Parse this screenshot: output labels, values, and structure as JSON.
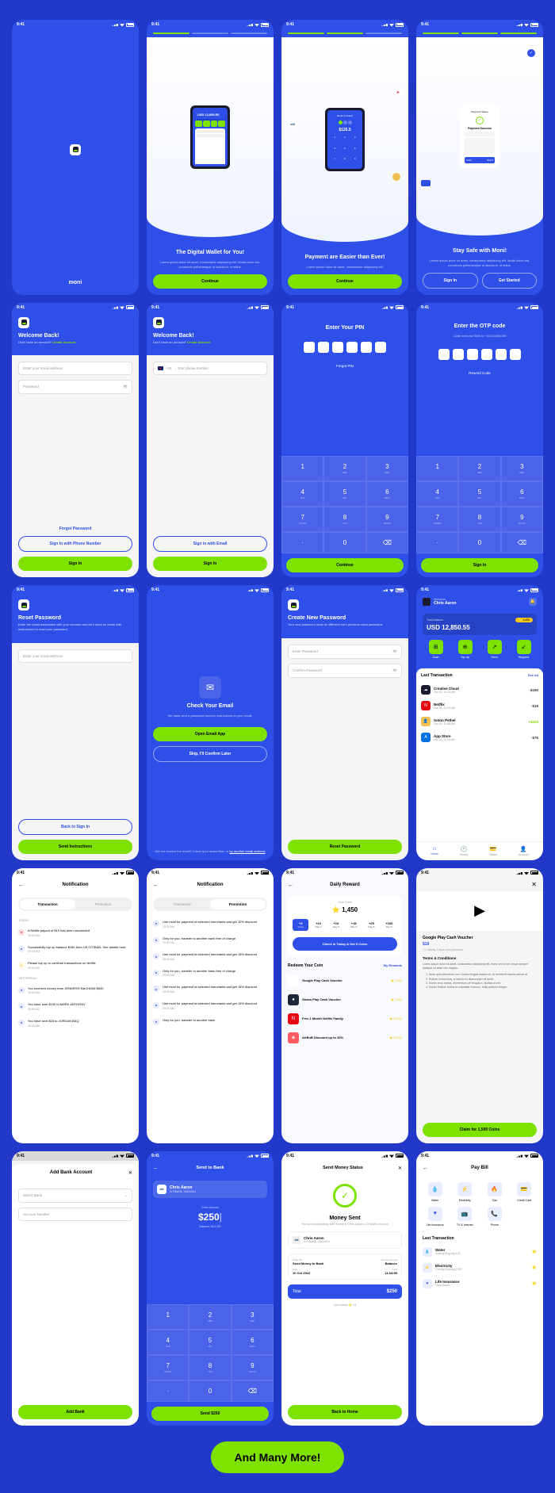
{
  "status_time": "9:41",
  "brand": "moni",
  "onboard1": {
    "title": "The Digital Wallet for You!",
    "subtitle": "Lorem ipsum dolor sit amet, consectetur adipiscing elit. Morbi dolor nisi, commodo pellentesque ut lacinia id, id tellus.",
    "cta": "Continue",
    "balance": "USD 12,850.55"
  },
  "onboard2": {
    "title": "Payment are Easier than Ever!",
    "subtitle": "Lorem ipsum dolor sit amet, consectetur adipiscing elit.",
    "cta": "Continue",
    "amount": "$125.5"
  },
  "onboard3": {
    "title": "Stay Safe with Moni!",
    "subtitle": "Lorem ipsum dolor sit amet, consectetur adipiscing elit. Morbi dolor nisi, commodo pellentesque ut lacinia id, id tellus.",
    "btn1": "Sign In",
    "btn2": "Get Started",
    "status": "Payment Success",
    "price": "$12.5"
  },
  "login": {
    "title": "Welcome Back!",
    "sub": "Don't have an account?",
    "link": "Create Account",
    "email_ph": "Enter your email address",
    "pass_ph": "Password",
    "forgot": "Forgot Password",
    "phone_btn": "Sign In with Phone Number",
    "signin": "Sign In",
    "phone_ph": "Your phone number",
    "code": "+44",
    "email_btn": "Sign in with Email"
  },
  "pin": {
    "title": "Enter Your PIN",
    "forgot": "Forgot PIN",
    "cta": "Continue"
  },
  "otp": {
    "title": "Enter the OTP code",
    "sub": "Code sent via SMS to +44123456789",
    "resend": "Resend Code",
    "cta": "Sign In"
  },
  "keypad": [
    "1",
    "2",
    "3",
    "4",
    "5",
    "6",
    "7",
    "8",
    "9",
    "·",
    "0",
    "⌫"
  ],
  "keypad_sub": [
    "",
    "ABC",
    "DEF",
    "GHI",
    "JKL",
    "MNO",
    "PQRS",
    "TUV",
    "WXYZ",
    "",
    "",
    ""
  ],
  "reset": {
    "title": "Reset Password",
    "sub": "Enter the email associated with your account and we'll send an email with instructions to reset your password.",
    "ph": "Enter your email address",
    "back": "Back to Sign In",
    "send": "Send Instructions"
  },
  "checkmail": {
    "title": "Check Your Email",
    "sub": "We have sent a password recover instructions to your email.",
    "open": "Open Email App",
    "skip": "Skip, I'll Confirm Later",
    "footer": "Did not receive the email? Check your spam filter, or",
    "link": "try another email address"
  },
  "newpass": {
    "title": "Create New Password",
    "sub": "Your new password must be different from previous used password.",
    "p1": "Enter Password",
    "p2": "Confirm Password",
    "cta": "Reset Password"
  },
  "home": {
    "welcome": "Welcome,",
    "name": "Chris Aaron",
    "bal_label": "Total Balance",
    "balance": "USD 12,850.55",
    "badge": "1,450",
    "actions": [
      "Scan",
      "Top Up",
      "Send",
      "Request"
    ],
    "action_icons": [
      "⊞",
      "⊕",
      "↗",
      "↙"
    ],
    "trans_title": "Last Transaction",
    "see_all": "See All"
  },
  "transactions": [
    {
      "icon": "☁",
      "bg": "#1a1a2e",
      "name": "Creative Cloud",
      "date": "Oct 16, 11:19 AM",
      "amount": "-$190"
    },
    {
      "icon": "N",
      "bg": "#E50914",
      "name": "Netflix",
      "date": "Oct 15, 11:19 AM",
      "amount": "-$19"
    },
    {
      "icon": "👤",
      "bg": "#f0c050",
      "name": "Soton Pethel",
      "date": "Oct 14, 11:48 AM",
      "amount": "+$250",
      "pos": true
    },
    {
      "icon": "A",
      "bg": "#0071e3",
      "name": "App Store",
      "date": "Oct 13, 11:19 AM",
      "amount": "-$76"
    }
  ],
  "nav": [
    "Home",
    "History",
    "Wallet",
    "Account"
  ],
  "notif": {
    "title": "Notification",
    "tab1": "Transaction",
    "tab2": "Promotion"
  },
  "notif_trans": {
    "today_label": "TODAY",
    "yesterday_label": "YESTERDAY",
    "today": [
      {
        "text": "A Netflix payout of $19 has been successfull",
        "time": "09:30 AM",
        "color": "#E50914"
      },
      {
        "text": "Successfully top up balance $180 from US CITIBAN. See details here.",
        "time": "09:30 AM",
        "color": "#2E4FE8"
      },
      {
        "text": "Please top up to continue transactions on Netflix",
        "time": "09:30 AM",
        "color": "#f5c518"
      }
    ],
    "yesterday": [
      {
        "text": "You received money from JENNIFER BACHDIM $640",
        "time": "09:30 AM",
        "color": "#2E4FE8"
      },
      {
        "text": "You have sent $100 to MARK ANTHONY",
        "time": "09:30 AM",
        "color": "#2E4FE8"
      },
      {
        "text": "You have sent $16 to JORDAN BAQ",
        "time": "09:30 AM",
        "color": "#2E4FE8"
      }
    ]
  },
  "notif_promo": [
    {
      "text": "Use moni for payment at selected merchants and get 10% discount",
      "time": "10:30 AM"
    },
    {
      "text": "Only for you, transfer to another bank free of charge",
      "time": "10:30 AM"
    },
    {
      "text": "Use moni for payment at selected merchants and get 15% discount",
      "time": "09:00 AM"
    },
    {
      "text": "Only for you, transfer to another bank free of charge",
      "time": "09:00 AM"
    },
    {
      "text": "Use moni for payment at selected merchants and get 15% discount",
      "time": "09:00 AM"
    },
    {
      "text": "Use moni for payment at selected merchants and get 15% discount",
      "time": "09:00 AM"
    },
    {
      "text": "Only for you, transfer to another bank",
      "time": ""
    }
  ],
  "daily": {
    "title": "Daily Reward",
    "coin_label": "Your Coins",
    "coins": "1,450",
    "cta": "Check In Today & Get 5 Coins",
    "redeem": "Redeem Your Coin",
    "my": "My Rewards"
  },
  "days": [
    {
      "v": "+5",
      "l": "Today",
      "active": true
    },
    {
      "v": "+10",
      "l": "Day 2"
    },
    {
      "v": "+10",
      "l": "Day 3"
    },
    {
      "v": "+15",
      "l": "Day 4"
    },
    {
      "v": "+25",
      "l": "Day 5"
    },
    {
      "v": "+100",
      "l": "Day 6"
    }
  ],
  "rewards": [
    {
      "icon": "▶",
      "bg": "#fff",
      "name": "Google Play Cash Voucher",
      "coin": "1,000"
    },
    {
      "icon": "●",
      "bg": "#1b2838",
      "name": "Steam Play Cash Voucher",
      "coin": "2,000"
    },
    {
      "icon": "N",
      "bg": "#E50914",
      "name": "Free 1 Month Netflix Family",
      "coin": "10,000"
    },
    {
      "icon": "◈",
      "bg": "#FF5A5F",
      "name": "AirBnB Discount up to 10%",
      "coin": "10,000"
    }
  ],
  "voucher": {
    "name": "Google Play Cash Voucher",
    "price": "$19",
    "validity": "Validity 7 days from purchase",
    "terms": "Terms & Conditions",
    "desc": "Lorem ipsum dolor sit amet, consectetur adipiscing elit. Nunc vel ex vel neque semper tristique sit amet nec magna.",
    "cta": "Claim for 1,500 Coins"
  },
  "addbank": {
    "title": "Add Bank Account",
    "select": "Select Bank",
    "acct": "Account Number",
    "cta": "Add Bank"
  },
  "sendbank": {
    "title": "Send to Bank",
    "name": "Chris Aaron",
    "acct": "CITIBANK 10004624",
    "enter": "Enter Amount",
    "amount": "$250",
    "bal": "Balance: $14,000",
    "cta": "Send $250"
  },
  "sent": {
    "title": "Send Money Status",
    "heading": "Money Sent",
    "sub": "You have successfully sent money to Chris Aaron's CITIBANK account",
    "name": "Chris Aaron",
    "acct": "CITIBANK 10004624",
    "type_lbl": "Order By",
    "type": "Send Money to Bank",
    "date_lbl": "Date",
    "date": "10 Oct 2022",
    "fund_lbl": "Source of Fund",
    "fund": "Balance",
    "time_lbl": "Time",
    "time": "11:04:59",
    "total_lbl": "Total",
    "total": "$250",
    "earned": "You earned ⭐ +3",
    "cta": "Back to Home"
  },
  "paybill": {
    "title": "Pay Bill",
    "items": [
      "Water",
      "Electricity",
      "Gas",
      "Credit Card",
      "Life Insurance",
      "TV & Internet",
      "Phone",
      ""
    ],
    "icons": [
      "💧",
      "⚡",
      "🔥",
      "💳",
      "♥",
      "📺",
      "📞",
      ""
    ],
    "last": "Last Transaction"
  },
  "bill_trans": [
    {
      "icon": "💧",
      "name": "Water",
      "sub": "Gotong Royong-123"
    },
    {
      "icon": "⚡",
      "name": "Electricity",
      "sub": "Gotong Royong-2322"
    },
    {
      "icon": "♥",
      "name": "Life Insurance",
      "sub": "Chris Aaron"
    }
  ],
  "footer": "And Many More!"
}
